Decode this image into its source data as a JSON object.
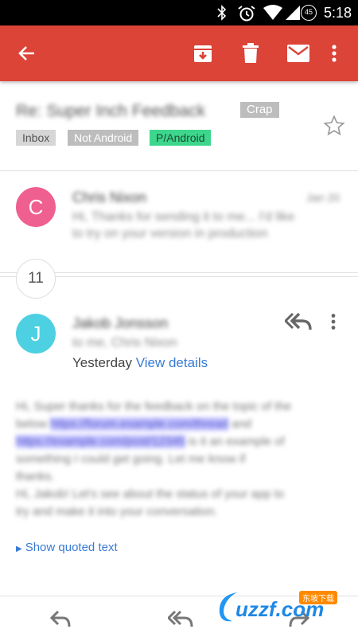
{
  "status_bar": {
    "battery": "45",
    "time": "5:18"
  },
  "app_bar": {
    "back_icon": "arrow-back-icon",
    "archive_icon": "archive-icon",
    "delete_icon": "trash-icon",
    "mark_unread_icon": "mail-icon",
    "overflow_icon": "more-vert-icon",
    "accent_color": "#db4437"
  },
  "subject": {
    "text": "Re: Super Inch Feedback",
    "labels": [
      "Crap",
      "Inbox",
      "Not Android",
      "P/Android"
    ]
  },
  "collapsed_message": {
    "avatar_letter": "C",
    "avatar_color": "#ef5f8f",
    "sender": "Chris Nixon",
    "date": "Jan 20",
    "snippet_line1": "Hi, Thanks for sending it to me... I'd like",
    "snippet_line2": "to try on your version in production"
  },
  "collapsed_count": "11",
  "expanded_message": {
    "avatar_letter": "J",
    "avatar_color": "#4dd0e1",
    "sender": "Jakob Jonsson",
    "recipient": "to me, Chris Nixon",
    "date_label": "Yesterday",
    "view_details": "View details",
    "body_line1": "Hi, Super thanks for the feedback on the topic of the",
    "body_line2_a": "below",
    "body_line2_link": "https://forum.example.com/thread",
    "body_line2_b": "and",
    "body_line3_link": "https://example.com/post/12345",
    "body_line3_b": "is it an example of",
    "body_line4": "something I could get going. Let me know if",
    "body_line5": "thanks.",
    "body_line6": "Hi, Jakob! Let's see about the status of your app to",
    "body_line7": "try and make it into your conversation.",
    "show_quoted": "Show quoted text"
  },
  "bottom_actions": {
    "reply_icon": "reply-icon",
    "reply_all_icon": "reply-all-icon",
    "forward_icon": "forward-icon"
  },
  "watermark": {
    "text": "uzzf.com",
    "cn": "东坡下载"
  }
}
